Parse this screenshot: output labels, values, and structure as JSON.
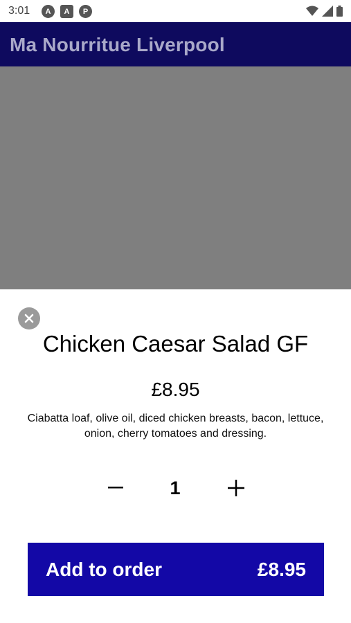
{
  "status_bar": {
    "time": "3:01",
    "icons": [
      "a-notification-icon",
      "a-square-notification-icon",
      "p-notification-icon",
      "wifi-icon",
      "signal-icon",
      "battery-icon"
    ],
    "icon_glyphs": [
      "A",
      "A",
      "P"
    ]
  },
  "app_bar": {
    "title": "Ma Nourritue Liverpool",
    "background": "#0e0a5e"
  },
  "hero": {
    "image_color": "#7f7f7f"
  },
  "item": {
    "title": "Chicken Caesar Salad GF",
    "price": "£8.95",
    "description": "Ciabatta loaf, olive oil, diced chicken breasts, bacon, lettuce, onion, cherry tomatoes and dressing."
  },
  "quantity": {
    "value": "1",
    "minus_icon": "minus-icon",
    "plus_icon": "plus-icon"
  },
  "add_button": {
    "label": "Add to order",
    "price": "£8.95",
    "background": "#1308a6"
  }
}
